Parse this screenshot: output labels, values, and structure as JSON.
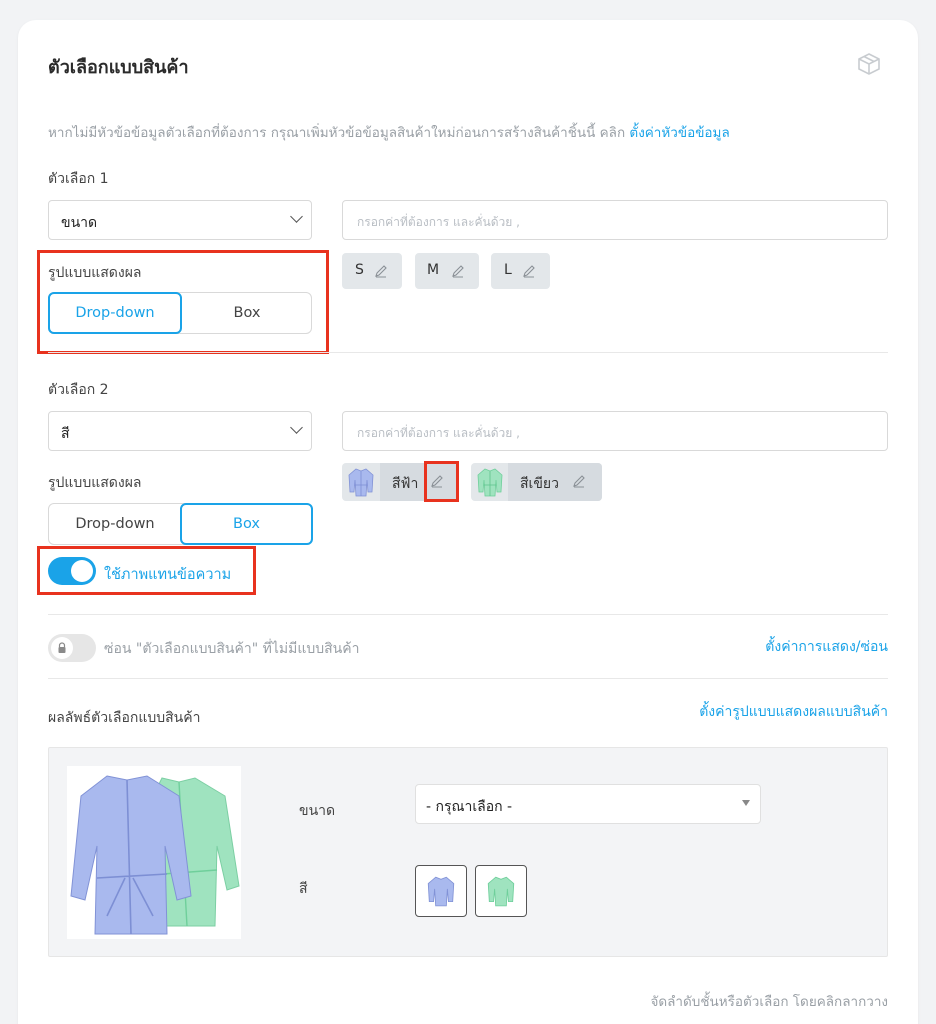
{
  "header": {
    "title": "ตัวเลือกแบบสินค้า",
    "icon": "box-icon"
  },
  "hint": {
    "text": "หากไม่มีหัวข้อข้อมูลตัวเลือกที่ต้องการ กรุณาเพิ่มหัวข้อข้อมูลสินค้าใหม่ก่อนการสร้างสินค้าชิ้นนี้ คลิก ",
    "link": "ตั้งค่าหัวข้อข้อมูล"
  },
  "option1": {
    "label": "ตัวเลือก 1",
    "select_value": "ขนาด",
    "input_placeholder": "กรอกค่าที่ต้องการ และคั่นด้วย ,",
    "display_label": "รูปแบบแสดงผล",
    "display_options": [
      "Drop-down",
      "Box"
    ],
    "display_selected": "Drop-down",
    "values": [
      "S",
      "M",
      "L"
    ]
  },
  "option2": {
    "label": "ตัวเลือก 2",
    "select_value": "สี",
    "input_placeholder": "กรอกค่าที่ต้องการ และคั่นด้วย ,",
    "display_label": "รูปแบบแสดงผล",
    "display_options": [
      "Drop-down",
      "Box"
    ],
    "display_selected": "Box",
    "values": [
      "สีฟ้า",
      "สีเขียว"
    ],
    "use_image_toggle": {
      "label": "ใช้ภาพแทนข้อความ",
      "on": true
    }
  },
  "hide_toggle": {
    "label": "ซ่อน \"ตัวเลือกแบบสินค้า\" ที่ไม่มีแบบสินค้า",
    "on": false,
    "link": "ตั้งค่าการแสดง/ซ่อน"
  },
  "result": {
    "label": "ผลลัพธ์ตัวเลือกแบบสินค้า",
    "link": "ตั้งค่ารูปแบบแสดงผลแบบสินค้า",
    "size_label": "ขนาด",
    "size_select": "- กรุณาเลือก -",
    "color_label": "สี"
  },
  "footer": {
    "note": "จัดลำดับชั้นหรือตัวเลือก โดยคลิกลากวาง"
  },
  "colors": {
    "accent": "#1aa3e8",
    "highlight": "#e8321e",
    "blue_shirt": "#a9b9ee",
    "green_shirt": "#9fe3bf"
  }
}
